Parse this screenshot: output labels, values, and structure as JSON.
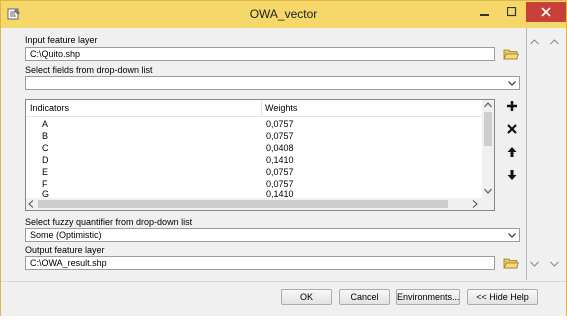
{
  "window": {
    "title": "OWA_vector"
  },
  "input_layer": {
    "label": "Input feature layer",
    "value": "C:\\Quito.shp"
  },
  "fields": {
    "label": "Select fields from drop-down list",
    "value": ""
  },
  "table": {
    "headers": [
      "Indicators",
      "Weights"
    ],
    "rows": [
      [
        "A",
        "0,0757"
      ],
      [
        "B",
        "0,0757"
      ],
      [
        "C",
        "0,0408"
      ],
      [
        "D",
        "0,1410"
      ],
      [
        "E",
        "0,0757"
      ],
      [
        "F",
        "0,0757"
      ],
      [
        "G",
        "0,1410"
      ]
    ]
  },
  "fuzzy": {
    "label": "Select fuzzy quantifier from drop-down list",
    "value": "Some (Optimistic)"
  },
  "output_layer": {
    "label": "Output feature layer",
    "value": "C:\\OWA_result.shp"
  },
  "buttons": {
    "ok": "OK",
    "cancel": "Cancel",
    "environments": "Environments...",
    "hide_help": "<< Hide Help"
  },
  "icons": {
    "app": "toolbox-icon",
    "folder": "folder-open-icon",
    "add": "plus-icon",
    "remove": "x-icon",
    "up": "arrow-up-icon",
    "down": "arrow-down-icon"
  },
  "colors": {
    "titlebar": "#f6d76a",
    "close_button": "#c7403a"
  }
}
